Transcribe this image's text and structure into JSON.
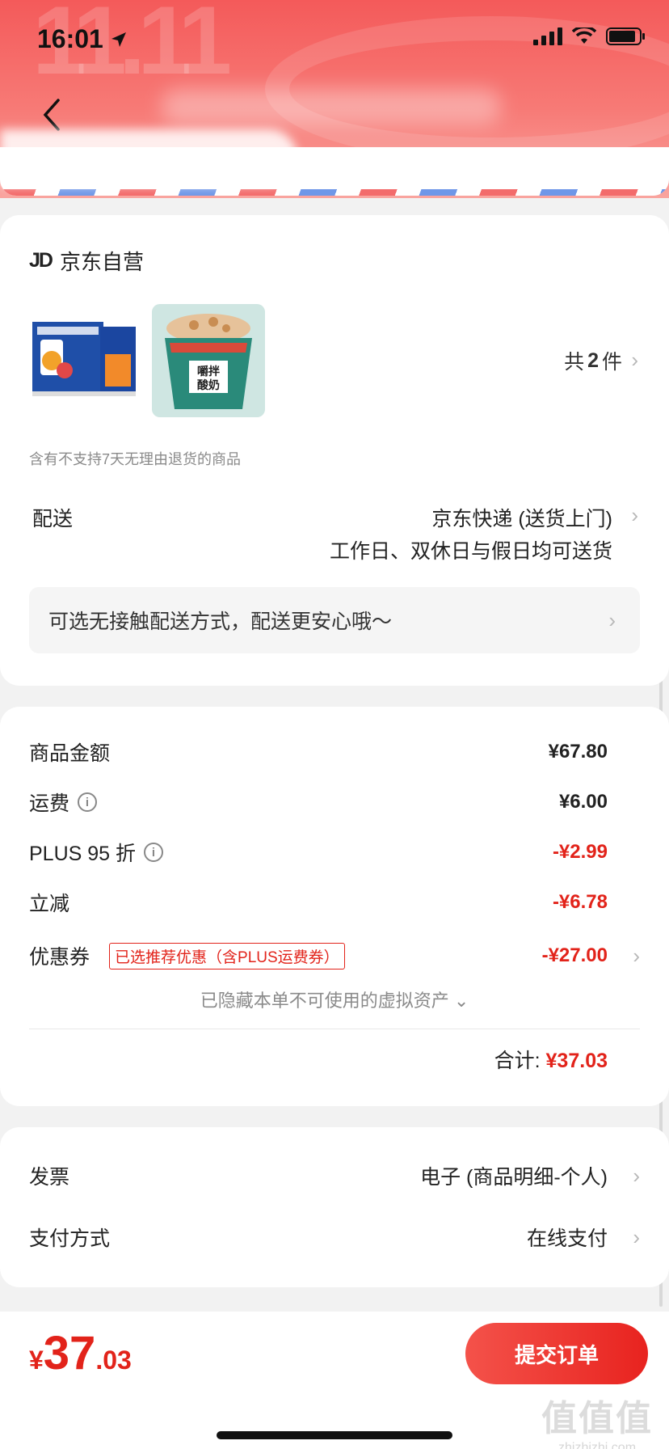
{
  "status_bar": {
    "time": "16:01"
  },
  "shop": {
    "logo": "JD",
    "name": "京东自营",
    "count_prefix": "共",
    "count": "2",
    "count_suffix": "件",
    "return_note": "含有不支持7天无理由退货的商品",
    "products": [
      {
        "image_icon": "milk-box-product-image"
      },
      {
        "image_icon": "yogurt-cup-product-image",
        "image_text": "嚼拌酸奶"
      }
    ]
  },
  "delivery": {
    "label": "配送",
    "method": "京东快递 (送货上门)",
    "schedule": "工作日、双休日与假日均可送货",
    "contactless": "可选无接触配送方式，配送更安心哦～"
  },
  "pricing": {
    "goods_label": "商品金额",
    "goods_value": "¥67.80",
    "shipping_label": "运费",
    "shipping_value": "¥6.00",
    "plus_label": "PLUS 95 折",
    "plus_value": "-¥2.99",
    "instant_label": "立减",
    "instant_value": "-¥6.78",
    "coupon_label": "优惠券",
    "coupon_tag": "已选推荐优惠（含PLUS运费券）",
    "coupon_value": "-¥27.00",
    "hidden_assets": "已隐藏本单不可使用的虚拟资产",
    "total_label": "合计:",
    "total_value": "¥37.03"
  },
  "invoice": {
    "label": "发票",
    "value": "电子 (商品明细-个人)",
    "pay_label": "支付方式",
    "pay_value": "在线支付"
  },
  "bottom": {
    "yen": "¥",
    "amount_int": "37",
    "amount_dec": ".03",
    "submit": "提交订单"
  },
  "watermark": {
    "big": "值值值",
    "small": "zhizhizhi.com"
  },
  "colors": {
    "accent": "#e2231a",
    "header": "#f45a5a"
  }
}
